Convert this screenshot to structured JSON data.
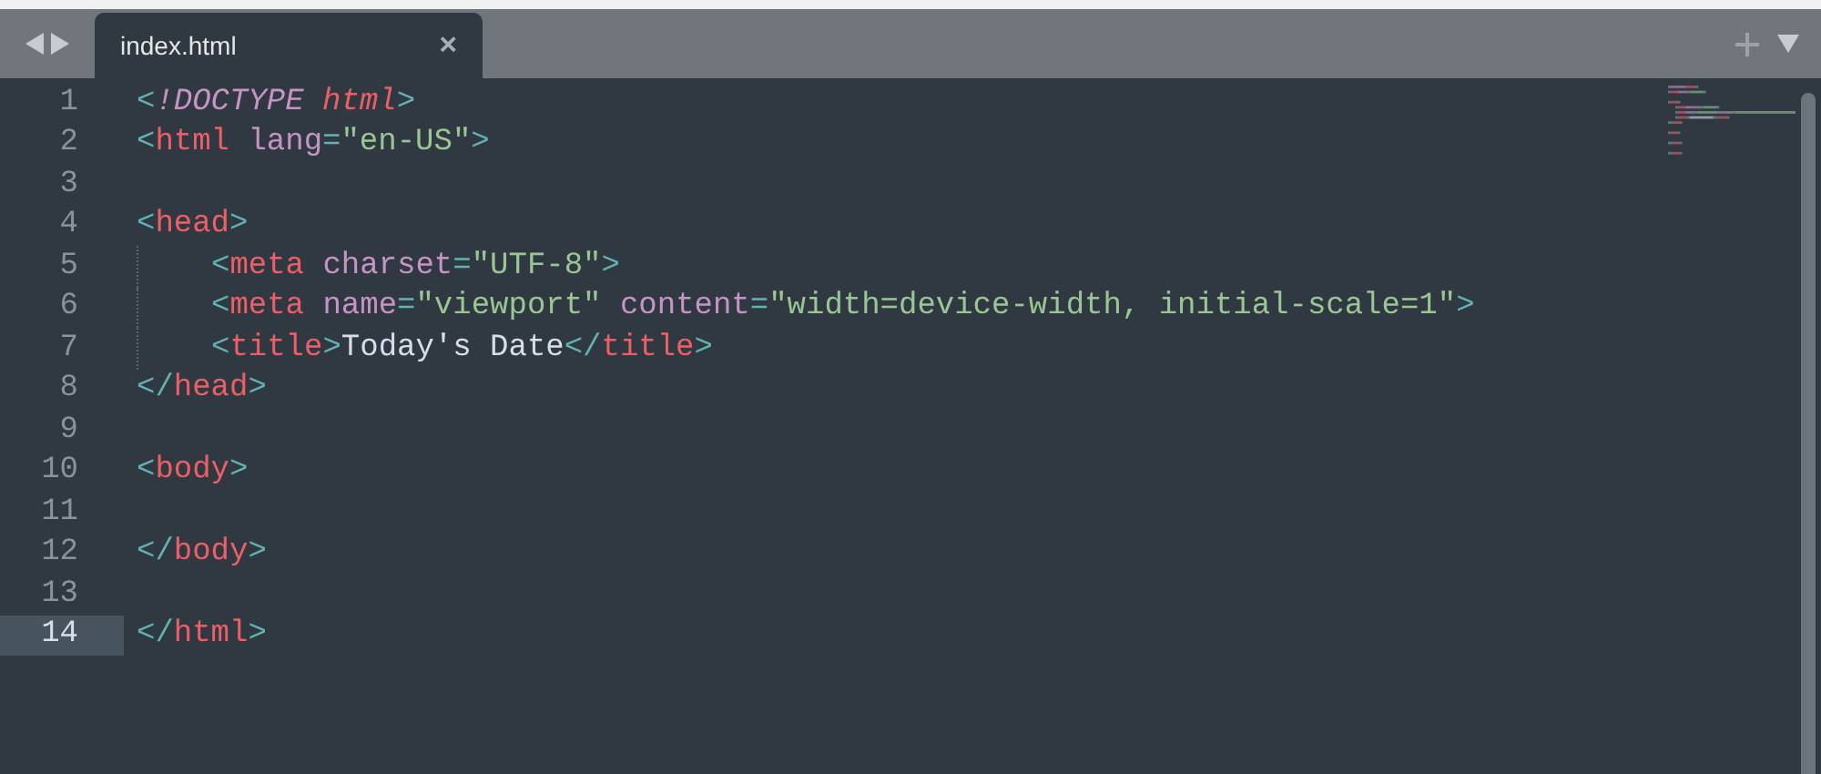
{
  "tabs": [
    {
      "label": "index.html",
      "selected": true,
      "close": "×"
    }
  ],
  "lines": [
    {
      "number": "1",
      "current": false,
      "indent": false,
      "tokens": [
        {
          "kind": "punct",
          "text": "<"
        },
        {
          "kind": "doctype",
          "text": "!DOCTYPE"
        },
        {
          "kind": "keyword",
          "text": " html"
        },
        {
          "kind": "punct",
          "text": ">"
        }
      ]
    },
    {
      "number": "2",
      "current": false,
      "indent": false,
      "tokens": [
        {
          "kind": "punct",
          "text": "<"
        },
        {
          "kind": "tag",
          "text": "html"
        },
        {
          "kind": "attr",
          "text": " lang"
        },
        {
          "kind": "punct",
          "text": "="
        },
        {
          "kind": "string",
          "text": "\"en-US\""
        },
        {
          "kind": "punct",
          "text": ">"
        }
      ]
    },
    {
      "number": "3",
      "current": false,
      "indent": false
    },
    {
      "number": "4",
      "current": false,
      "indent": false,
      "tokens": [
        {
          "kind": "punct",
          "text": "<"
        },
        {
          "kind": "tag",
          "text": "head"
        },
        {
          "kind": "punct",
          "text": ">"
        }
      ]
    },
    {
      "number": "5",
      "current": false,
      "indent": true,
      "tokens": [
        {
          "kind": "punct",
          "text": "<"
        },
        {
          "kind": "tag",
          "text": "meta"
        },
        {
          "kind": "attr",
          "text": " charset"
        },
        {
          "kind": "punct",
          "text": "="
        },
        {
          "kind": "string",
          "text": "\"UTF-8\""
        },
        {
          "kind": "punct",
          "text": ">"
        }
      ]
    },
    {
      "number": "6",
      "current": false,
      "indent": true,
      "tokens": [
        {
          "kind": "punct",
          "text": "<"
        },
        {
          "kind": "tag",
          "text": "meta"
        },
        {
          "kind": "attr",
          "text": " name"
        },
        {
          "kind": "punct",
          "text": "="
        },
        {
          "kind": "string",
          "text": "\"viewport\""
        },
        {
          "kind": "attr",
          "text": " content"
        },
        {
          "kind": "punct",
          "text": "="
        },
        {
          "kind": "string",
          "text": "\"width=device-width, initial-scale=1\""
        },
        {
          "kind": "punct",
          "text": ">"
        }
      ]
    },
    {
      "number": "7",
      "current": false,
      "indent": true,
      "tokens": [
        {
          "kind": "punct",
          "text": "<"
        },
        {
          "kind": "tag",
          "text": "title"
        },
        {
          "kind": "punct",
          "text": ">"
        },
        {
          "kind": "plain",
          "text": "Today's Date"
        },
        {
          "kind": "punct",
          "text": "</"
        },
        {
          "kind": "tag",
          "text": "title"
        },
        {
          "kind": "punct",
          "text": ">"
        }
      ]
    },
    {
      "number": "8",
      "current": false,
      "indent": false,
      "tokens": [
        {
          "kind": "punct",
          "text": "</"
        },
        {
          "kind": "tag",
          "text": "head"
        },
        {
          "kind": "punct",
          "text": ">"
        }
      ]
    },
    {
      "number": "9",
      "current": false,
      "indent": false
    },
    {
      "number": "10",
      "current": false,
      "indent": false,
      "tokens": [
        {
          "kind": "punct",
          "text": "<"
        },
        {
          "kind": "tag",
          "text": "body"
        },
        {
          "kind": "punct",
          "text": ">"
        }
      ]
    },
    {
      "number": "11",
      "current": false,
      "indent": false
    },
    {
      "number": "12",
      "current": false,
      "indent": false,
      "tokens": [
        {
          "kind": "punct",
          "text": "</"
        },
        {
          "kind": "tag",
          "text": "body"
        },
        {
          "kind": "punct",
          "text": ">"
        }
      ]
    },
    {
      "number": "13",
      "current": false,
      "indent": false
    },
    {
      "number": "14",
      "current": true,
      "indent": false,
      "tokens": [
        {
          "kind": "punct",
          "text": "</"
        },
        {
          "kind": "tag",
          "text": "html"
        },
        {
          "kind": "punct",
          "text": ">"
        }
      ]
    }
  ]
}
